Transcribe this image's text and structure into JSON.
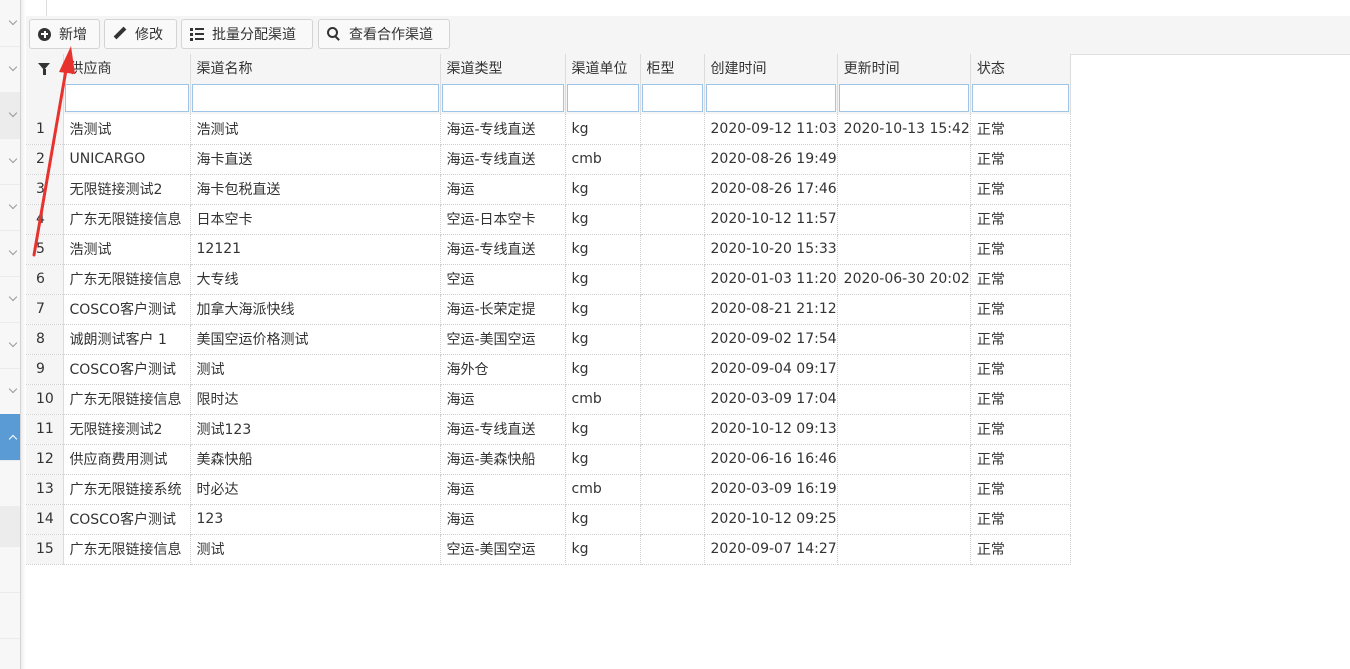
{
  "toolbar": {
    "add_label": "新增",
    "edit_label": "修改",
    "batch_assign_label": "批量分配渠道",
    "view_partner_label": "查看合作渠道"
  },
  "table": {
    "columns": [
      "供应商",
      "渠道名称",
      "渠道类型",
      "渠道单位",
      "柜型",
      "创建时间",
      "更新时间",
      "状态"
    ],
    "rows": [
      {
        "n": "1",
        "supplier": "浩测试",
        "channel": "浩测试",
        "type": "海运-专线直送",
        "unit": "kg",
        "cabinet": "",
        "created": "2020-09-12 11:03",
        "updated": "2020-10-13 15:42",
        "status": "正常"
      },
      {
        "n": "2",
        "supplier": "UNICARGO",
        "channel": "海卡直送",
        "type": "海运-专线直送",
        "unit": "cmb",
        "cabinet": "",
        "created": "2020-08-26 19:49",
        "updated": "",
        "status": "正常"
      },
      {
        "n": "3",
        "supplier": "无限链接测试2",
        "channel": "海卡包税直送",
        "type": "海运",
        "unit": "kg",
        "cabinet": "",
        "created": "2020-08-26 17:46",
        "updated": "",
        "status": "正常"
      },
      {
        "n": "4",
        "supplier": "广东无限链接信息",
        "channel": "日本空卡",
        "type": "空运-日本空卡",
        "unit": "kg",
        "cabinet": "",
        "created": "2020-10-12 11:57",
        "updated": "",
        "status": "正常"
      },
      {
        "n": "5",
        "supplier": "浩测试",
        "channel": "12121",
        "type": "海运-专线直送",
        "unit": "kg",
        "cabinet": "",
        "created": "2020-10-20 15:33",
        "updated": "",
        "status": "正常"
      },
      {
        "n": "6",
        "supplier": "广东无限链接信息",
        "channel": "大专线",
        "type": "空运",
        "unit": "kg",
        "cabinet": "",
        "created": "2020-01-03 11:20",
        "updated": "2020-06-30 20:02",
        "status": "正常"
      },
      {
        "n": "7",
        "supplier": "COSCO客户测试",
        "channel": "加拿大海派快线",
        "type": "海运-长荣定提",
        "unit": "kg",
        "cabinet": "",
        "created": "2020-08-21 21:12",
        "updated": "",
        "status": "正常"
      },
      {
        "n": "8",
        "supplier": "诚朗测试客户 1",
        "channel": "美国空运价格测试",
        "type": "空运-美国空运",
        "unit": "kg",
        "cabinet": "",
        "created": "2020-09-02 17:54",
        "updated": "",
        "status": "正常"
      },
      {
        "n": "9",
        "supplier": "COSCO客户测试",
        "channel": "测试",
        "type": "海外仓",
        "unit": "kg",
        "cabinet": "",
        "created": "2020-09-04 09:17",
        "updated": "",
        "status": "正常"
      },
      {
        "n": "10",
        "supplier": "广东无限链接信息",
        "channel": "限时达",
        "type": "海运",
        "unit": "cmb",
        "cabinet": "",
        "created": "2020-03-09 17:04",
        "updated": "",
        "status": "正常"
      },
      {
        "n": "11",
        "supplier": "无限链接测试2",
        "channel": "测试123",
        "type": "海运-专线直送",
        "unit": "kg",
        "cabinet": "",
        "created": "2020-10-12 09:13",
        "updated": "",
        "status": "正常"
      },
      {
        "n": "12",
        "supplier": "供应商费用测试",
        "channel": "美森快船",
        "type": "海运-美森快船",
        "unit": "kg",
        "cabinet": "",
        "created": "2020-06-16 16:46",
        "updated": "",
        "status": "正常"
      },
      {
        "n": "13",
        "supplier": "广东无限链接系统",
        "channel": "时必达",
        "type": "海运",
        "unit": "cmb",
        "cabinet": "",
        "created": "2020-03-09 16:19",
        "updated": "",
        "status": "正常"
      },
      {
        "n": "14",
        "supplier": "COSCO客户测试",
        "channel": "123",
        "type": "海运",
        "unit": "kg",
        "cabinet": "",
        "created": "2020-10-12 09:25",
        "updated": "",
        "status": "正常"
      },
      {
        "n": "15",
        "supplier": "广东无限链接信息",
        "channel": "测试",
        "type": "空运-美国空运",
        "unit": "kg",
        "cabinet": "",
        "created": "2020-09-07 14:27",
        "updated": "",
        "status": "正常"
      }
    ]
  },
  "colors": {
    "annotation_arrow": "#e8322e",
    "sidebar_active": "#5b9bd5",
    "filter_border": "#9ec5e8"
  },
  "icons": [
    "plus-circle-icon",
    "pencil-icon",
    "list-icon",
    "search-icon",
    "filter-icon",
    "chevron-icon"
  ]
}
